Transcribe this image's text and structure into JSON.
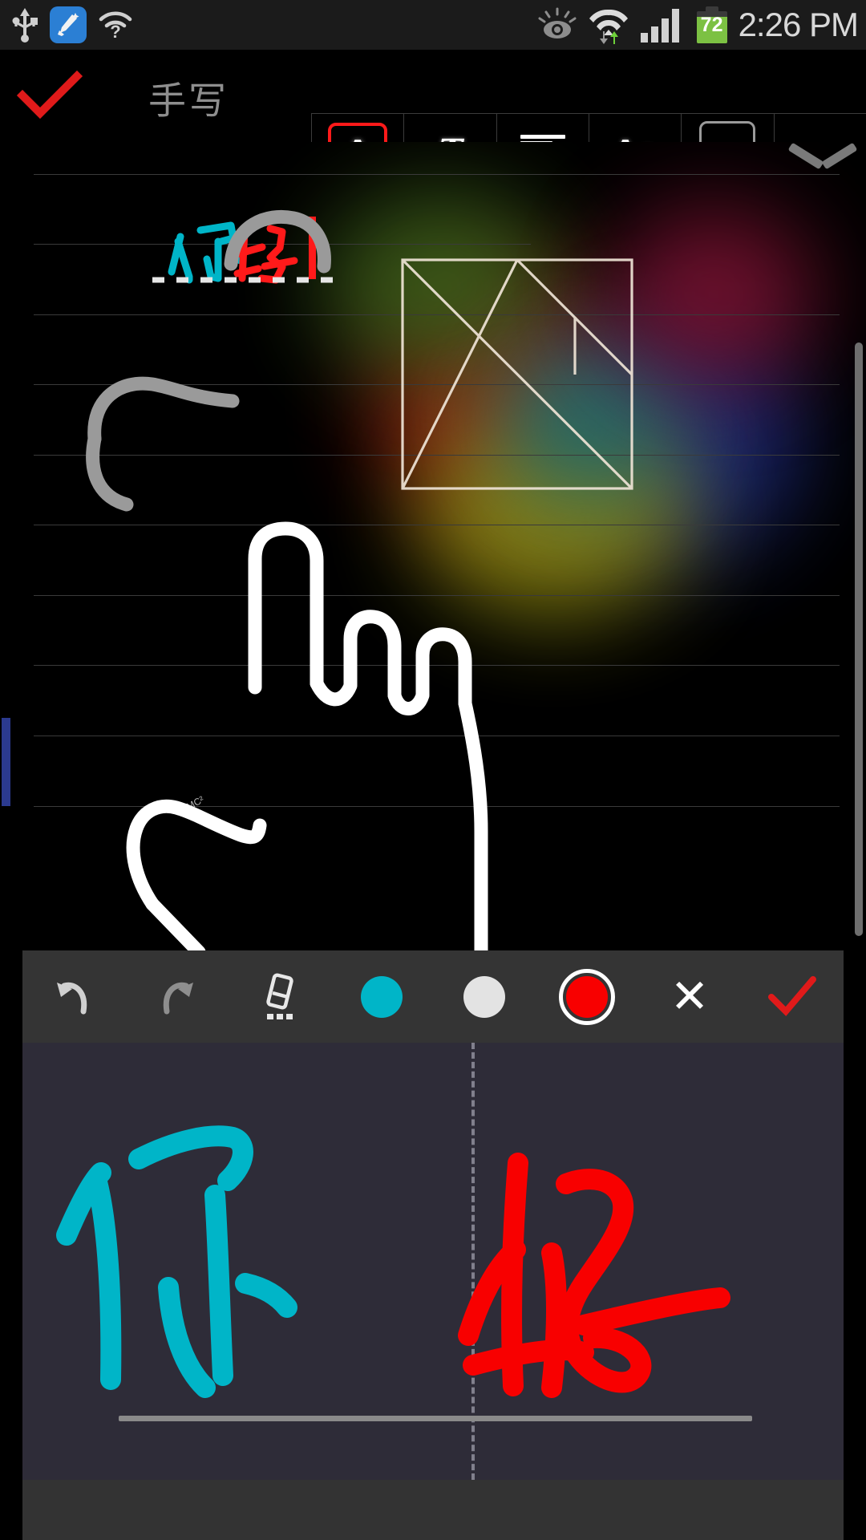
{
  "status_bar": {
    "left_icons": [
      "usb-icon",
      "cleaner-app-icon",
      "wifi-question-icon"
    ],
    "right_icons": [
      "smart-stay-eye-icon",
      "wifi-transfer-icon",
      "signal-bars-icon"
    ],
    "battery_percent": "72",
    "time": "2:26 PM"
  },
  "top_bar": {
    "confirm_label": "✓",
    "title": "手写",
    "format_tools": [
      {
        "name": "font-style-button",
        "glyph": "A",
        "selected": true
      },
      {
        "name": "text-format-button",
        "glyph": "T",
        "has_dropdown": true,
        "selected": false
      },
      {
        "name": "align-button",
        "glyph": "align-left",
        "selected": false
      },
      {
        "name": "font-size-button",
        "glyph": "Aa",
        "selected": false
      },
      {
        "name": "text-color-button",
        "glyph": "color-swatch",
        "color": "#ff1a1a",
        "has_dropdown": true,
        "selected": false
      },
      {
        "name": "highlight-color-button",
        "glyph": "color-swatch",
        "color": "#00b5c8",
        "selected": false
      }
    ],
    "collapse_label": "chevron-down"
  },
  "canvas": {
    "note_text_cyan": "你",
    "note_text_red": "好",
    "caret_color": "#ff1a1a",
    "tiny_annotation": "E=MC²",
    "rule_line_color": "#3a3a3a",
    "left_marker_color": "#2b3a8f",
    "shape_name": "tangram-square-sketch"
  },
  "bottom_toolbar": {
    "items": [
      {
        "name": "undo-button",
        "glyph": "↶"
      },
      {
        "name": "redo-button",
        "glyph": "↷"
      },
      {
        "name": "eraser-button",
        "glyph": "eraser"
      },
      {
        "name": "color-cyan-button",
        "color": "#00b5c8",
        "selected": false
      },
      {
        "name": "color-white-button",
        "color": "#e3e3e3",
        "selected": false
      },
      {
        "name": "color-red-button",
        "color": "#f80000",
        "selected": true
      },
      {
        "name": "cancel-button",
        "glyph": "✕"
      },
      {
        "name": "confirm-button",
        "glyph": "✓"
      }
    ]
  },
  "handwrite_panel": {
    "stroke_left": "你",
    "stroke_right": "好",
    "stroke_left_color": "#00b5c8",
    "stroke_right_color": "#f80000",
    "divider": "dashed-vertical",
    "baseline": "baseline-rule"
  },
  "colors": {
    "accent_red": "#ff1a1a",
    "accent_cyan": "#00b5c8",
    "panel_bg": "#2e2c38",
    "toolbar_bg": "#343434",
    "status_bg": "#1b1b1b"
  }
}
